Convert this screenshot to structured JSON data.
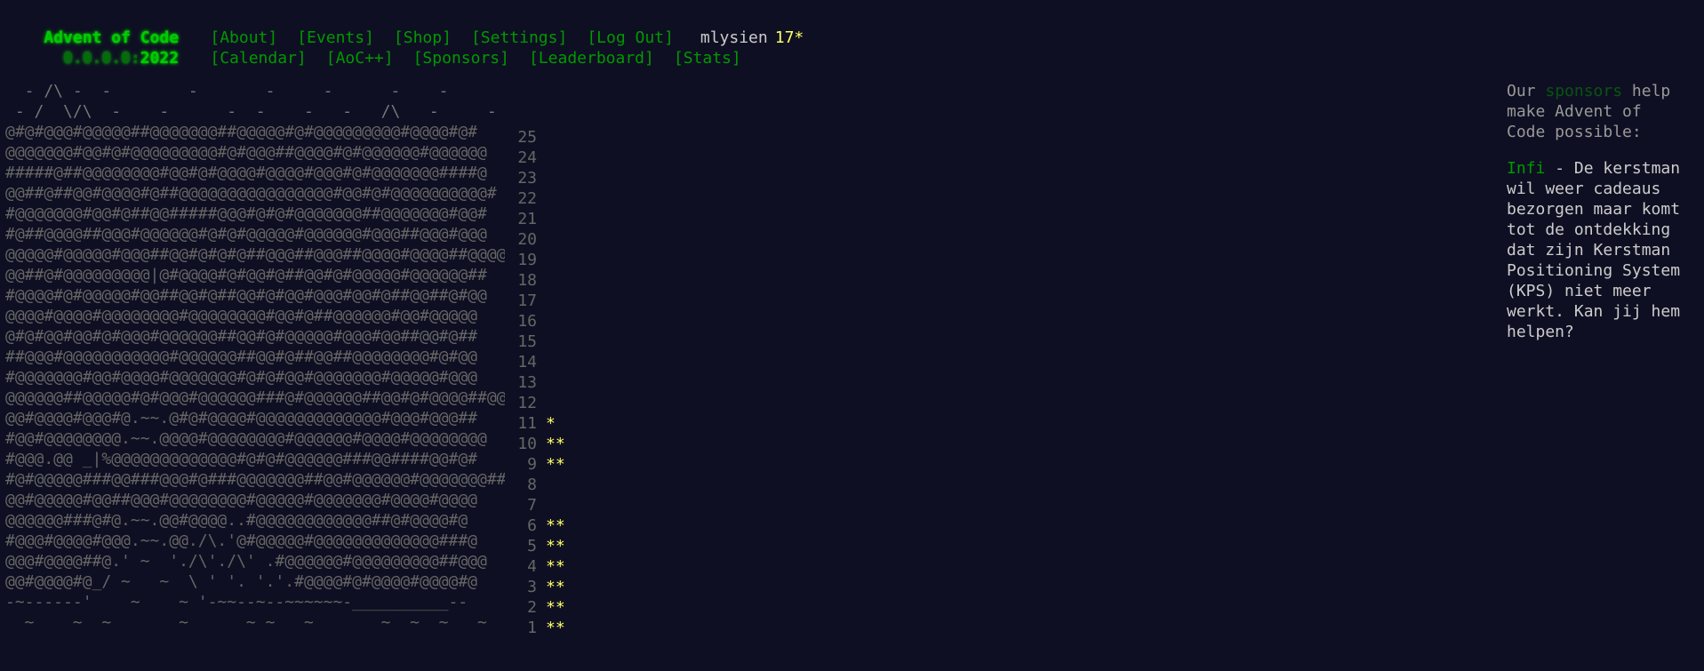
{
  "header": {
    "logo": "Advent of Code",
    "year_prefix": "  0.0.0.0:",
    "year": "2022",
    "nav_row1": [
      "[About]",
      "[Events]",
      "[Shop]",
      "[Settings]",
      "[Log Out]"
    ],
    "nav_row2": [
      "[Calendar]",
      "[AoC++]",
      "[Sponsors]",
      "[Leaderboard]",
      "[Stats]"
    ],
    "username": "mlysien",
    "user_stars": "17*"
  },
  "calendar": {
    "top_rows": [
      "  - /\\ -  -        -       -     -      -    -",
      " - /  \\/\\  -    -      -  -    -   -   /\\   -     -"
    ],
    "rows": [
      {
        "art": "@#@#@@@#@@@@@##@@@@@@@##@@@@@#@#@@@@@@@@@#@@@@#@#",
        "day": "25",
        "stars": ""
      },
      {
        "art": "@@@@@@@#@@#@#@@@@@@@@@#@#@@@##@@@@#@#@@@@@@#@@@@@@",
        "day": "24",
        "stars": ""
      },
      {
        "art": "#####@##@@@@@@@@#@@#@#@@@@#@@@@#@@@#@#@@@@@@@####@",
        "day": "23",
        "stars": ""
      },
      {
        "art": "@@##@##@@#@@@@#@##@@@@@@@@@@@@@@@@#@@#@#@@@@@@@@@@#",
        "day": "22",
        "stars": ""
      },
      {
        "art": "#@@@@@@@#@@#@##@@#####@@@#@#@#@@@@@@@##@@@@@@@#@@#",
        "day": "21",
        "stars": ""
      },
      {
        "art": "#@##@@@@##@@@#@@@@@@#@#@#@@@@@#@@@@@@#@@@##@@@#@@@",
        "day": "20",
        "stars": ""
      },
      {
        "art": "@@@@@#@@@@@#@@@##@@#@#@#@##@@@##@@@##@@@@#@@@@##@@@@#",
        "day": "19",
        "stars": ""
      },
      {
        "art": "@@##@#@@@@@@@@@|@#@@@@#@#@@#@##@@#@#@@@@@#@@@@@@##",
        "day": "18",
        "stars": ""
      },
      {
        "art": "#@@@@#@#@@@@@#@@##@@#@##@@#@#@@#@@@#@@#@##@@##@#@@",
        "day": "17",
        "stars": ""
      },
      {
        "art": "@@@@#@@@@#@@@@@@@@#@@@@@@@@#@@#@##@@@@@@#@@#@@@@@",
        "day": "16",
        "stars": ""
      },
      {
        "art": "@#@#@@#@@#@#@@@#@@@@@@##@@#@#@@@@@#@@@#@@##@@#@##",
        "day": "15",
        "stars": ""
      },
      {
        "art": "##@@@#@@@@@@@@@@@#@@@@@@##@@#@##@@##@@@@@@@@#@#@@",
        "day": "14",
        "stars": ""
      },
      {
        "art": "#@@@@@@@#@@#@@@@#@@@@@@@#@#@#@@#@@@@@@@#@@@@@#@@@",
        "day": "13",
        "stars": ""
      },
      {
        "art": "@@@@@@##@@@@@#@#@@@#@@@@@@###@#@@@@@@##@@#@#@@@@##@@",
        "day": "12",
        "stars": ""
      },
      {
        "art": "@@#@@@@#@@@#@.~~.@#@#@@@@#@@@@@@@@@@@@@#@@@#@@@##",
        "day": "11",
        "stars": "*"
      },
      {
        "art": "#@@#@@@@@@@@.~~.@@@@#@@@@@@@@#@@@@@@#@@@@#@@@@@@@@",
        "day": "10",
        "stars": "**"
      },
      {
        "art": "#@@@.@@ _|%@@@@@@@@@@@@@#@#@#@@@@@@###@@####@@#@#",
        "day": "9",
        "stars": "**"
      },
      {
        "art": "#@#@@@@@###@@###@@@#@###@@@@@@@##@@#@@@@@@#@@@@@@@###@",
        "day": "8",
        "stars": ""
      },
      {
        "art": "@@#@@@@@#@@##@@@#@@@@@@@@#@@@@@#@@@@@@@#@@@@#@@@@",
        "day": "7",
        "stars": ""
      },
      {
        "art": "@@@@@@###@#@.~~.@@#@@@@..#@@@@@@@@@@@@##@#@@@@#@",
        "day": "6",
        "stars": "**"
      },
      {
        "art": "#@@@#@@@@#@@@.~~.@@./\\.'@#@@@@@#@@@@@@@@@@@@@###@",
        "day": "5",
        "stars": "**"
      },
      {
        "art": "@@@#@@@@##@.' ~  './\\'./\\' .#@@@@@@#@@@@@@@@@##@@@",
        "day": "4",
        "stars": "**"
      },
      {
        "art": "@@#@@@@#@_/ ~   ~  \\ ' '. '.'.#@@@@#@#@@@@#@@@@#@",
        "day": "3",
        "stars": "**"
      },
      {
        "art": "-~------'    ~    ~ '-~~--~--~~~~~~-__________--",
        "day": "2",
        "stars": "**"
      },
      {
        "art": "  ~    ~  ~       ~      ~ ~   ~       ~  ~  ~   ~",
        "day": "1",
        "stars": "**"
      }
    ]
  },
  "sidebar": {
    "intro_before": "Our ",
    "intro_link": "sponsors",
    "intro_after": " help make Advent of Code possible:",
    "sponsor_name": "Infi",
    "sponsor_text": " - De kerstman wil weer cadeaus bezorgen maar komt tot de ontdekking dat zijn Kerstman Positioning System (KPS) niet meer werkt. Kan jij hem helpen?"
  }
}
